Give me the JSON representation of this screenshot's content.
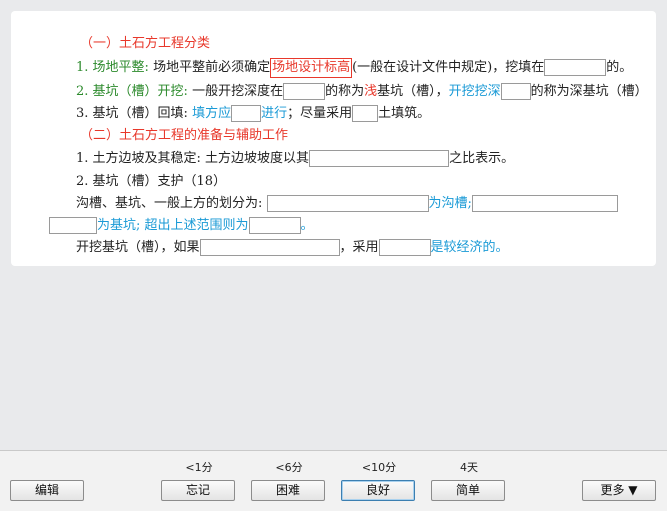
{
  "card": {
    "h1": "（一）土石方工程分类",
    "l1": {
      "num": "1. ",
      "title": "场地平整:",
      "t1": " 场地平整前必须确定",
      "boxed": "场地设计标高",
      "t2": "(一般在设计文件中规定)，挖填在",
      "t3": "的。"
    },
    "l2": {
      "num": "2. ",
      "title": "基坑（槽）开挖:",
      "t1": " 一般开挖深度在",
      "t2": "的称为",
      "shallow": "浅",
      "t3": "基坑（槽），",
      "blue": "开挖挖深",
      "t4": "的称为深基坑（槽）"
    },
    "l3": {
      "t1": "3. 基坑（槽）回填: ",
      "blue1": "填方应",
      "blue2": "进行",
      "t2": "；尽量采用",
      "t3": "土填筑。"
    },
    "h2": "（二）土石方工程的准备与辅助工作",
    "l4": {
      "t1": "1. 土方边坡及其稳定: 土方边坡坡度以其",
      "t2": "之比表示。"
    },
    "l5": "2. 基坑（槽）支护（18）",
    "l6": {
      "t1": "沟槽、基坑、一般上方的划分为: ",
      "blue": "为沟槽;"
    },
    "l7": {
      "blue1": "为基坑;",
      "blue2": " 超出上述范围则为",
      "blue3": "。"
    },
    "l8": {
      "t1": "开挖基坑（槽），如果",
      "t2": "，采用",
      "blue": "是较经济的。"
    }
  },
  "toolbar": {
    "edit_label": "编辑",
    "more_label": "更多 ▼",
    "options": [
      {
        "time": "<1分",
        "label": "忘记"
      },
      {
        "time": "<6分",
        "label": "困难"
      },
      {
        "time": "<10分",
        "label": "良好"
      },
      {
        "time": "4天",
        "label": "简单"
      }
    ]
  }
}
